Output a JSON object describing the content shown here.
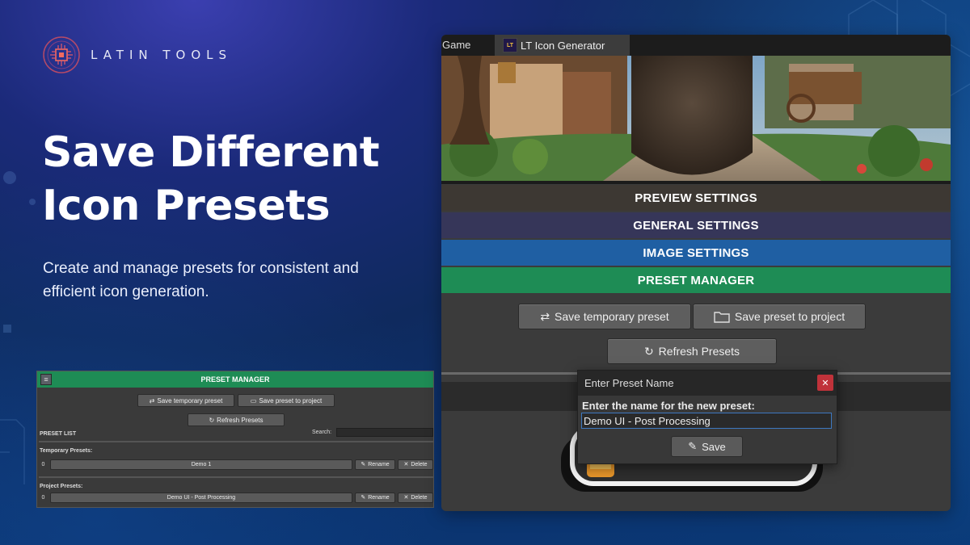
{
  "brand": {
    "name": "LATIN TOOLS"
  },
  "hero": {
    "headline": "Save Different Icon Presets",
    "subtext": "Create and manage presets for consistent and efficient icon generation."
  },
  "mini_panel": {
    "header": "PRESET MANAGER",
    "save_temporary_label": "Save temporary preset",
    "save_project_label": "Save preset to project",
    "refresh_label": "Refresh Presets",
    "preset_list_label": "PRESET LIST",
    "search_label": "Search:",
    "temporary_heading": "Temporary Presets:",
    "project_heading": "Project Presets:",
    "temporary_presets": [
      {
        "index": "0",
        "name": "Demo 1",
        "rename": "Rename",
        "delete": "Delete"
      }
    ],
    "project_presets": [
      {
        "index": "0",
        "name": "Demo UI - Post Processing",
        "rename": "Rename",
        "delete": "Delete"
      }
    ]
  },
  "editor_window": {
    "tabs": [
      {
        "label": "Game"
      },
      {
        "label": "LT Icon Generator",
        "icon": "lt-logo-icon",
        "active": true
      }
    ],
    "sections": [
      {
        "label": "PREVIEW SETTINGS",
        "color": "#3d3833"
      },
      {
        "label": "GENERAL SETTINGS",
        "color": "#363659"
      },
      {
        "label": "IMAGE SETTINGS",
        "color": "#1f5fa3"
      },
      {
        "label": "PRESET MANAGER",
        "color": "#1e8c55"
      }
    ],
    "save_temporary_label": "Save temporary preset",
    "save_project_label": "Save preset to project",
    "refresh_label": "Refresh Presets"
  },
  "dialog": {
    "title": "Enter Preset Name",
    "prompt": "Enter the name for the new preset:",
    "input_value": "Demo UI - Post Processing",
    "save_label": "Save"
  },
  "colors": {
    "accent_green": "#1e8c55",
    "close_red": "#c0323a",
    "input_focus": "#3d78c0"
  }
}
